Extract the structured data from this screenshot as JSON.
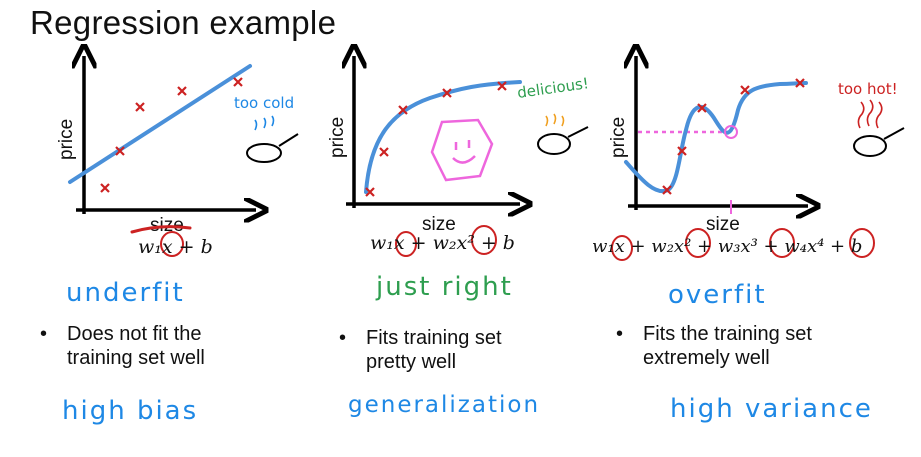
{
  "title": "Regression example",
  "colors": {
    "fit_line": "#4a90d9",
    "points": "#cc2222",
    "handwriting_blue": "#1e88e5",
    "handwriting_green": "#2e9e4f",
    "annotation_red": "#cc2222",
    "pink": "#ee66dd",
    "orange": "#f0a020"
  },
  "panels": [
    {
      "ylabel": "price",
      "xlabel": "size",
      "formula": "w₁x + b",
      "fit_label": "underfit",
      "bullet": [
        "Does not fit the",
        "training set well"
      ],
      "diagnosis": "high bias",
      "note": "too cold"
    },
    {
      "ylabel": "price",
      "xlabel": "size",
      "formula": "w₁x + w₂x² + b",
      "fit_label": "just right",
      "bullet": [
        "Fits training set",
        "pretty well"
      ],
      "diagnosis": "generalization",
      "note": "delicious!"
    },
    {
      "ylabel": "price",
      "xlabel": "size",
      "formula": "w₁x + w₂x² + w₃x³ + w₄x⁴ + b",
      "fit_label": "overfit",
      "bullet": [
        "Fits the training set",
        "extremely well"
      ],
      "diagnosis": "high variance",
      "note": "too hot!"
    }
  ]
}
